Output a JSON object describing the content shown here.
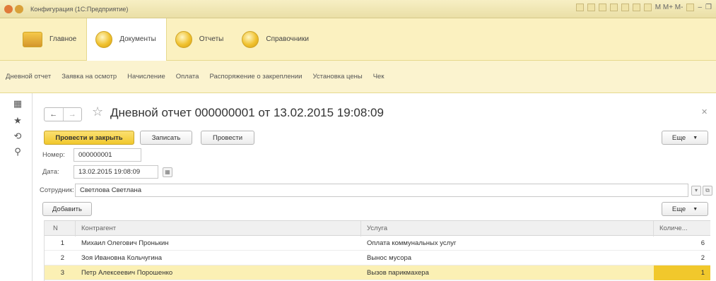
{
  "window": {
    "title": "Конфигурация (1С:Предприятие)",
    "right_text": "M  M+  M-"
  },
  "sections": [
    {
      "label": "Главное"
    },
    {
      "label": "Документы"
    },
    {
      "label": "Отчеты"
    },
    {
      "label": "Справочники"
    }
  ],
  "functions": [
    "Дневной отчет",
    "Заявка на осмотр",
    "Начисление",
    "Оплата",
    "Распоряжение о закреплении",
    "Установка цены",
    "Чек"
  ],
  "doc": {
    "title": "Дневной отчет 000000001 от 13.02.2015 19:08:09",
    "btn_post_close": "Провести и закрыть",
    "btn_save": "Записать",
    "btn_post": "Провести",
    "btn_more": "Еще",
    "number_label": "Номер:",
    "number_value": "000000001",
    "date_label": "Дата:",
    "date_value": "13.02.2015 19:08:09",
    "employee_label": "Сотрудник:",
    "employee_value": "Светлова Светлана",
    "btn_add": "Добавить",
    "btn_more2": "Еще"
  },
  "table": {
    "columns": [
      "N",
      "Контрагент",
      "Услуга",
      "Количе..."
    ],
    "rows": [
      {
        "n": "1",
        "contractor": "Михаил Олегович Пронькин",
        "service": "Оплата коммунальных услуг",
        "qty": "6"
      },
      {
        "n": "2",
        "contractor": "Зоя Ивановна Кольчугина",
        "service": "Вынос мусора",
        "qty": "2"
      },
      {
        "n": "3",
        "contractor": "Петр Алексеевич Порошенко",
        "service": "Вызов парикмахера",
        "qty": "1"
      }
    ]
  }
}
